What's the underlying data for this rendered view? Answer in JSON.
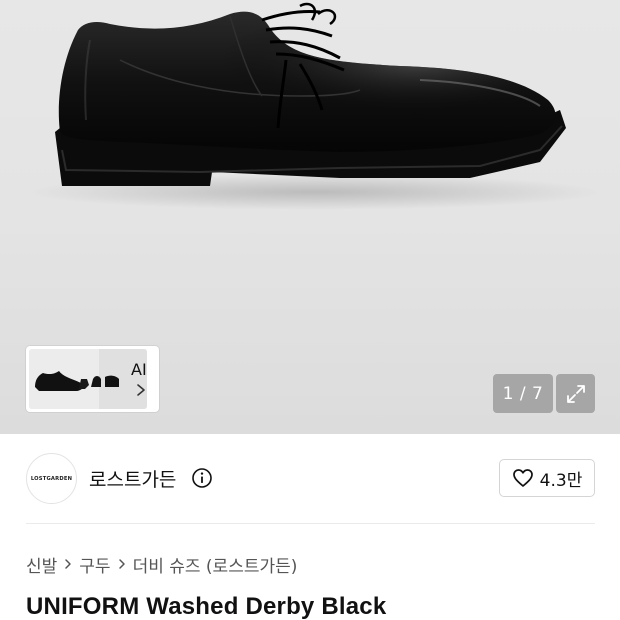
{
  "gallery": {
    "counter": "1 / 7",
    "ai_label": "AI"
  },
  "brand": {
    "logo_text": "LOSTGARDEN",
    "name": "로스트가든"
  },
  "like": {
    "count": "4.3만"
  },
  "breadcrumb": {
    "items": [
      "신발",
      "구두",
      "더비 슈즈 (로스트가든)"
    ]
  },
  "product": {
    "title": "UNIFORM Washed Derby Black"
  },
  "colors": {
    "background": "#ffffff",
    "hero_background": "#e5e5e5",
    "overlay_button": "#8a8a8a",
    "text_primary": "#111111",
    "text_secondary": "#555555",
    "border": "#d5d5d5"
  },
  "icons": {
    "expand": "expand-icon",
    "info": "info-icon",
    "heart": "heart-icon",
    "chevron": "chevron-right-icon"
  }
}
